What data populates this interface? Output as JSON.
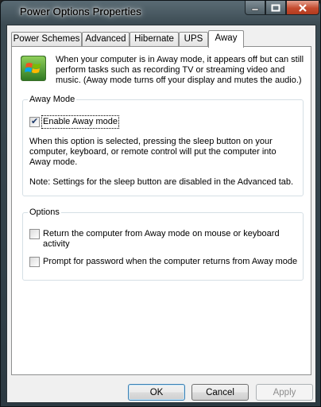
{
  "window": {
    "title": "Power Options Properties"
  },
  "tabs": [
    {
      "label": "Power Schemes"
    },
    {
      "label": "Advanced"
    },
    {
      "label": "Hibernate"
    },
    {
      "label": "UPS"
    },
    {
      "label": "Away"
    }
  ],
  "active_tab": "Away",
  "intro_text": "When your computer is in Away mode, it appears off but can still perform tasks such as recording TV or streaming video and music. (Away mode turns off your display and mutes the audio.)",
  "away_mode": {
    "group_label": "Away Mode",
    "checkbox_label": "Enable Away mode",
    "checked": true,
    "description": "When this option is selected, pressing the sleep button on your computer, keyboard, or remote control will put the computer into Away mode.",
    "note": "Note: Settings for the sleep button are disabled in the Advanced tab."
  },
  "options": {
    "group_label": "Options",
    "return_label": "Return the computer from Away mode on mouse or keyboard activity",
    "return_checked": false,
    "password_label": "Prompt for password when the computer returns from Away mode",
    "password_checked": false
  },
  "buttons": {
    "ok": "OK",
    "cancel": "Cancel",
    "apply": "Apply"
  }
}
